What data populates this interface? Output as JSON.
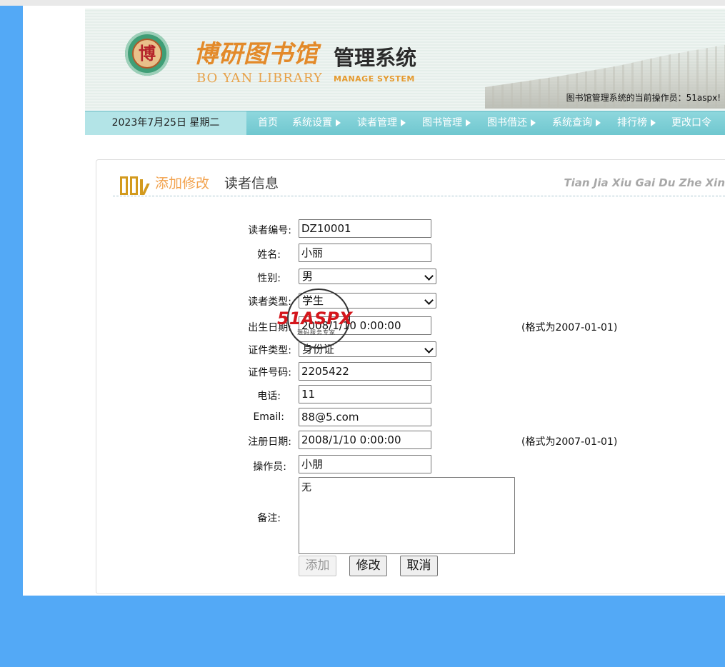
{
  "header": {
    "logo_seal_char": "博",
    "logo_cn": "博研图书馆",
    "logo_cn2": "管理系统",
    "logo_en": "BO YAN LIBRARY",
    "logo_en2": "MANAGE SYSTEM",
    "operator_line": "图书馆管理系统的当前操作员：51aspx!"
  },
  "nav": {
    "date": "2023年7月25日 星期二",
    "items": [
      {
        "label": "首页",
        "has_submenu": false
      },
      {
        "label": "系统设置",
        "has_submenu": true
      },
      {
        "label": "读者管理",
        "has_submenu": true
      },
      {
        "label": "图书管理",
        "has_submenu": true
      },
      {
        "label": "图书借还",
        "has_submenu": true
      },
      {
        "label": "系统查询",
        "has_submenu": true
      },
      {
        "label": "排行榜",
        "has_submenu": true
      },
      {
        "label": "更改口令",
        "has_submenu": false
      }
    ]
  },
  "section": {
    "title_highlight": "添加修改",
    "title_rest": "读者信息",
    "title_pinyin": "Tian Jia Xiu Gai Du Zhe Xin"
  },
  "form": {
    "reader_id": {
      "label": "读者编号:",
      "value": "DZ10001"
    },
    "name": {
      "label": "姓名:",
      "value": "小丽"
    },
    "gender": {
      "label": "性别:",
      "value": "男"
    },
    "reader_type": {
      "label": "读者类型:",
      "value": "学生"
    },
    "birth_date": {
      "label": "出生日期:",
      "value": "2008/1/10 0:00:00",
      "hint": "(格式为2007-01-01)"
    },
    "id_type": {
      "label": "证件类型:",
      "value": "身份证"
    },
    "id_number": {
      "label": "证件号码:",
      "value": "2205422"
    },
    "phone": {
      "label": "电话:",
      "value": "11"
    },
    "email": {
      "label": "Email:",
      "value": "88@5.com"
    },
    "register_date": {
      "label": "注册日期:",
      "value": "2008/1/10 0:00:00",
      "hint": "(格式为2007-01-01)"
    },
    "operator": {
      "label": "操作员:",
      "value": "小朋"
    },
    "remark": {
      "label": "备注:",
      "value": "无"
    }
  },
  "buttons": {
    "add": {
      "label": "添加",
      "disabled": true
    },
    "modify": {
      "label": "修改",
      "disabled": false
    },
    "cancel": {
      "label": "取消",
      "disabled": false
    }
  },
  "watermark": {
    "brand": "51ASPX",
    "tagline": "源码服务专家"
  },
  "colors": {
    "page_bg": "#53a9f6",
    "nav_bg": "#6fc7cf",
    "nav_date_bg": "#b3e4e7",
    "title_accent": "#f2a24d",
    "logo_orange": "#e38a2a"
  }
}
